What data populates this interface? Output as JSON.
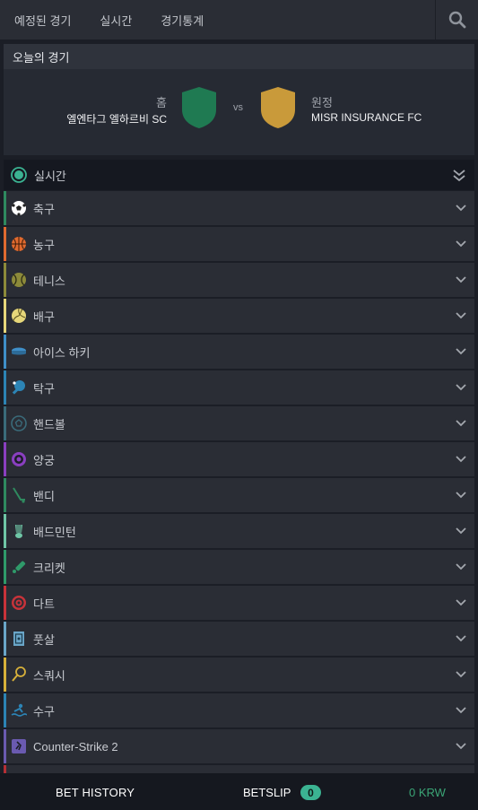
{
  "nav": {
    "tabs": [
      "예정된 경기",
      "실시간",
      "경기통계"
    ],
    "search_icon": "search-icon"
  },
  "today": {
    "title": "오늘의 경기",
    "home_label": "홈",
    "home_team": "엘엔타그 엘하르비 SC",
    "vs": "vs",
    "away_label": "원정",
    "away_team": "MISR INSURANCE FC",
    "home_color": "#1f7a52",
    "away_color": "#c99a3a"
  },
  "live": {
    "label": "실시간",
    "icon": "live-indicator-icon",
    "accent": "#3bb392"
  },
  "sports": [
    {
      "label": "축구",
      "icon": "soccer-ball-icon",
      "color": "#2f8a5f"
    },
    {
      "label": "농구",
      "icon": "basketball-icon",
      "color": "#e06a2f"
    },
    {
      "label": "테니스",
      "icon": "tennis-ball-icon",
      "color": "#8c8a3a"
    },
    {
      "label": "배구",
      "icon": "volleyball-icon",
      "color": "#e6d77a"
    },
    {
      "label": "아이스 하키",
      "icon": "hockey-puck-icon",
      "color": "#3f8fc8"
    },
    {
      "label": "탁구",
      "icon": "table-tennis-icon",
      "color": "#2c84b5"
    },
    {
      "label": "핸드볼",
      "icon": "handball-icon",
      "color": "#3a6b7a"
    },
    {
      "label": "양궁",
      "icon": "archery-target-icon",
      "color": "#8a3fc0"
    },
    {
      "label": "밴디",
      "icon": "bandy-stick-icon",
      "color": "#2f8a5f"
    },
    {
      "label": "배드민턴",
      "icon": "shuttlecock-icon",
      "color": "#6fc6a6"
    },
    {
      "label": "크리켓",
      "icon": "cricket-bat-icon",
      "color": "#2f9a6a"
    },
    {
      "label": "다트",
      "icon": "dartboard-icon",
      "color": "#c8333a"
    },
    {
      "label": "풋살",
      "icon": "futsal-field-icon",
      "color": "#6aa6c8"
    },
    {
      "label": "스쿼시",
      "icon": "squash-racket-icon",
      "color": "#d6b03a"
    },
    {
      "label": "수구",
      "icon": "water-polo-icon",
      "color": "#2c84b5"
    },
    {
      "label": "Counter-Strike 2",
      "icon": "counter-strike-icon",
      "color": "#6a5ab0"
    }
  ],
  "bottom": {
    "bet_history": "BET HISTORY",
    "betslip": "BETSLIP",
    "betslip_count": "0",
    "balance": "0 KRW"
  }
}
